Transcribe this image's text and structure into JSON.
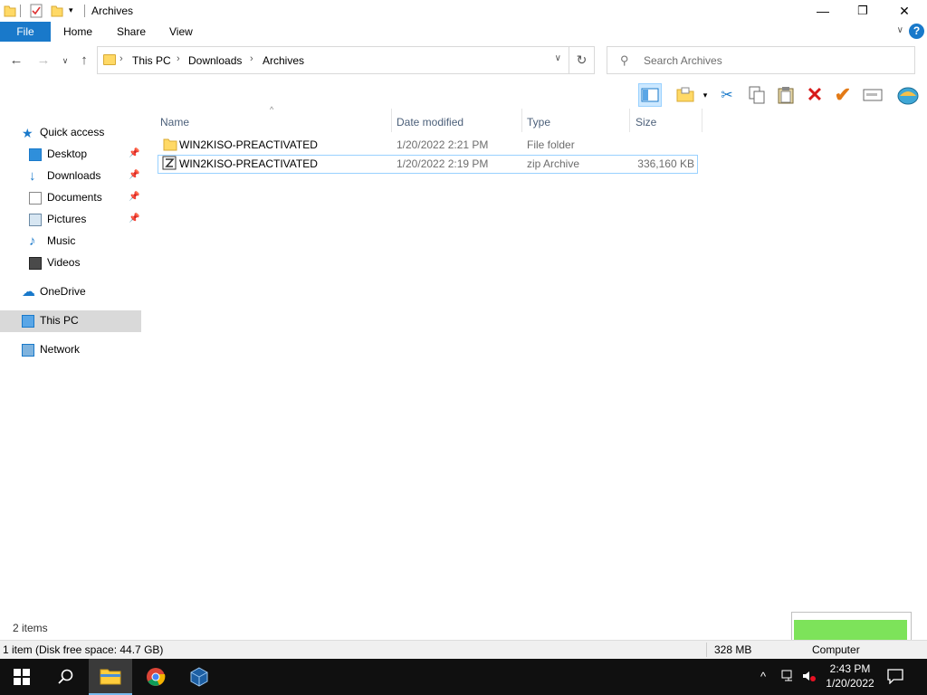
{
  "window": {
    "title": "Archives",
    "minimize": "—",
    "maximize": "❐",
    "close": "✕"
  },
  "ribbon": {
    "tabs": [
      "File",
      "Home",
      "Share",
      "View"
    ],
    "help": "?"
  },
  "address": {
    "crumbs": [
      "This PC",
      "Downloads",
      "Archives"
    ],
    "search_placeholder": "Search Archives"
  },
  "nav": {
    "quick_access": "Quick access",
    "desktop": "Desktop",
    "downloads": "Downloads",
    "documents": "Documents",
    "pictures": "Pictures",
    "music": "Music",
    "videos": "Videos",
    "onedrive": "OneDrive",
    "this_pc": "This PC",
    "network": "Network"
  },
  "columns": {
    "name": "Name",
    "date": "Date modified",
    "type": "Type",
    "size": "Size"
  },
  "files": [
    {
      "name": "WIN2KISO-PREACTIVATED",
      "date": "1/20/2022 2:21 PM",
      "type": "File folder",
      "size": ""
    },
    {
      "name": "WIN2KISO-PREACTIVATED",
      "date": "1/20/2022 2:19 PM",
      "type": "zip Archive",
      "size": "336,160 KB"
    }
  ],
  "status": {
    "item_count": "2 items",
    "selection": "1 item (Disk free space: 44.7 GB)",
    "size": "328 MB",
    "location": "Computer"
  },
  "clock": {
    "time": "2:43 PM",
    "date": "1/20/2022"
  },
  "colors": {
    "accent": "#1979ca",
    "selection_border": "#99d1ff",
    "nav_selected": "#d9d9d9",
    "taskbar": "#101010",
    "widget_green": "#7de35a"
  }
}
